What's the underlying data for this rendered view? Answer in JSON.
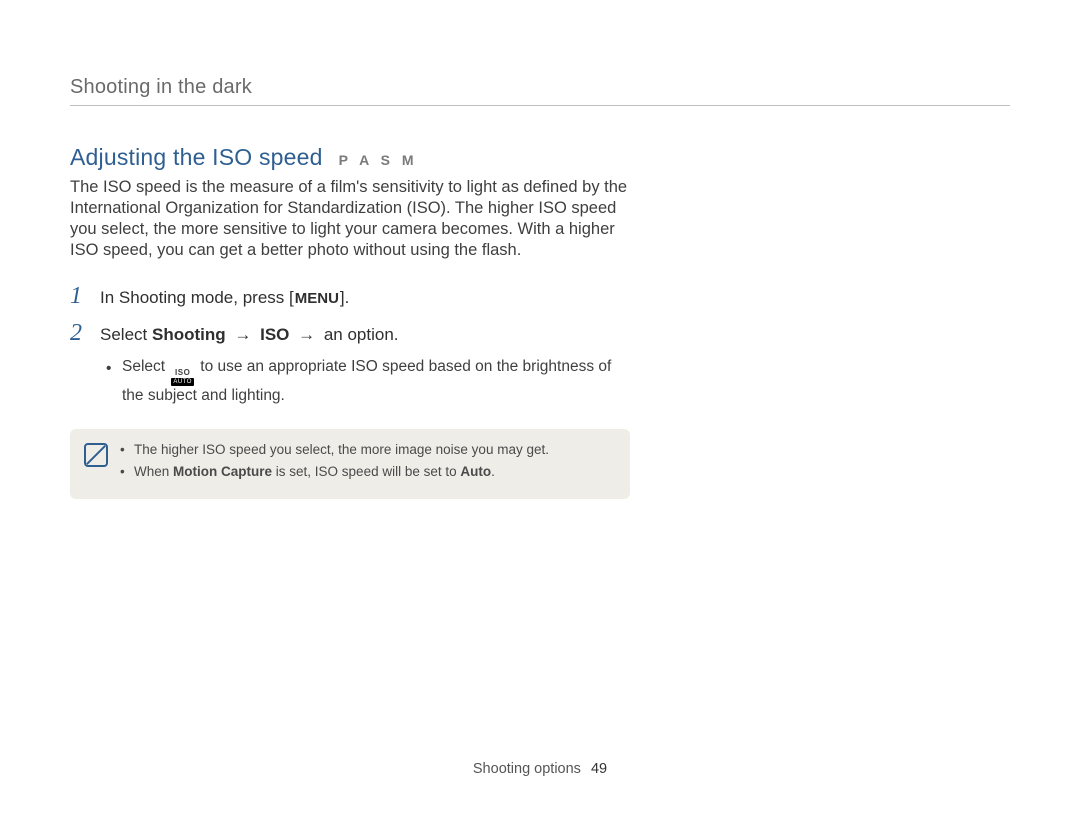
{
  "breadcrumb": "Shooting in the dark",
  "heading": "Adjusting the ISO speed",
  "modes": "P A S M",
  "intro": "The ISO speed is the measure of a film's sensitivity to light as defined by the International Organization for Standardization (ISO). The higher ISO speed you select, the more sensitive to light your camera becomes. With a higher ISO speed, you can get a better photo without using the flash.",
  "steps": {
    "s1": {
      "num": "1",
      "prefix": "In Shooting mode, press [",
      "menu": "MENU",
      "suffix": "]."
    },
    "s2": {
      "num": "2",
      "t1": "Select ",
      "t2": "Shooting",
      "arrow": " → ",
      "t3": "ISO",
      "t4": " an option.",
      "sub": {
        "pre": "Select ",
        "iso_top": "ISO",
        "iso_bot": "AUTO",
        "post": " to use an appropriate ISO speed based on the brightness of the subject and lighting."
      }
    }
  },
  "note": {
    "n1": "The higher ISO speed you select, the more image noise you may get.",
    "n2_a": "When ",
    "n2_b": "Motion Capture",
    "n2_c": " is set, ISO speed will be set to ",
    "n2_d": "Auto",
    "n2_e": "."
  },
  "footer": {
    "section": "Shooting options",
    "page": "49"
  }
}
